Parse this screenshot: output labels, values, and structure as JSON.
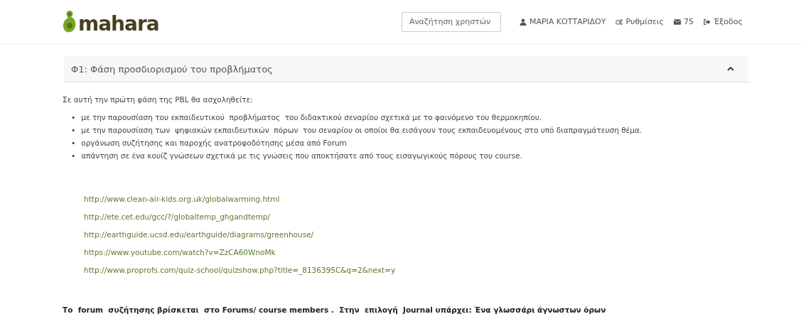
{
  "header": {
    "logo": "mahara",
    "search": {
      "placeholder": "Αναζήτηση χρηστών"
    },
    "nav": [
      {
        "kind": "user",
        "label": "ΜΑΡΙΑ ΚΟΤΤΑΡΙΔΟΥ"
      },
      {
        "kind": "settings",
        "label": "Ρυθμίσεις"
      },
      {
        "kind": "mail",
        "label": "75"
      },
      {
        "kind": "logout",
        "label": "Έξοδος"
      }
    ]
  },
  "panel": {
    "title": "Φ1: Φάση προσδιορισμού του προβλήματος",
    "expanded": true,
    "intro": "Σε αυτή την πρώτη φάση της PBL θα ασχοληθείτε:",
    "bullets": [
      {
        "marker": "•",
        "text": "με την παρουσίαση του εκπαιδευτικού  προβλήματος  του διδακτικού σεναρίου σχετικά με το φαινόμενο του θερμοκηπίου."
      },
      {
        "marker": "•",
        "text": "με την παρουσίαση των  ψηφιακών εκπαιδευτικών  πόρων  του σεναρίου οι οποίοι θα εισάγουν τους εκπαιδευομένους στο υπό διαπραγμάτευση θέμα."
      },
      {
        "marker": "•",
        "text": "οργάνωση συζήτησης και παροχής ανατροφοδότησης μέσα από Forum"
      },
      {
        "marker": "•",
        "text": "απάντηση σε ένα κουίζ γνώσεων σχετικά με τις γνώσεις που αποκτήσατε από τους εισαγωγικούς πόρους του course."
      }
    ],
    "links": [
      "http://www.clean-air-kids.org.uk/globalwarming.html",
      "http://ete.cet.edu/gcc/?/globaltemp_ghgandtemp/",
      "http://earthguide.ucsd.edu/earthguide/diagrams/greenhouse/",
      "https://www.youtube.com/watch?v=ZzCA60WnoMk",
      "http://www.proprofs.com/quiz-school/quizshow.php?title=_8136395C&q=2&next=y"
    ],
    "footer": "Το  forum  συζήτησης βρίσκεται  στο Forums/ course members .  Στην  επιλογή  Journal υπάρχει: Ένα γλωσσάρι άγνωστων όρων"
  }
}
